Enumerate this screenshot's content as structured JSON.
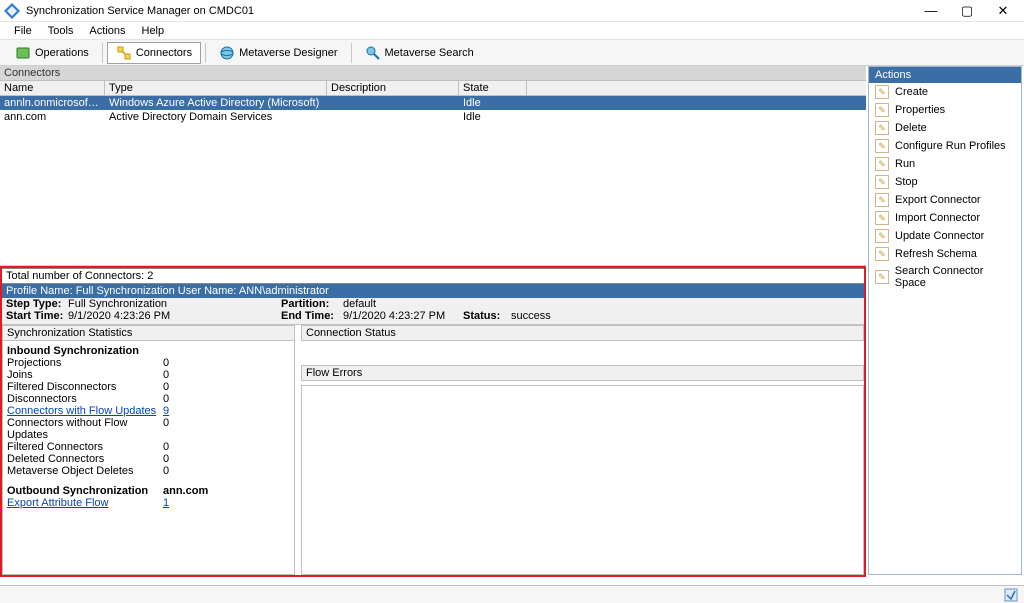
{
  "window": {
    "title": "Synchronization Service Manager on CMDC01"
  },
  "menu": {
    "file": "File",
    "tools": "Tools",
    "actions": "Actions",
    "help": "Help"
  },
  "toolbar": {
    "operations": "Operations",
    "connectors": "Connectors",
    "metaverse_designer": "Metaverse Designer",
    "metaverse_search": "Metaverse Search"
  },
  "connectors": {
    "title": "Connectors",
    "cols": {
      "name": "Name",
      "type": "Type",
      "description": "Description",
      "state": "State"
    },
    "rows": [
      {
        "name": "annln.onmicrosoft.com ...",
        "type": "Windows Azure Active Directory (Microsoft)",
        "description": "",
        "state": "Idle",
        "selected": true
      },
      {
        "name": "ann.com",
        "type": "Active Directory Domain Services",
        "description": "",
        "state": "Idle",
        "selected": false
      }
    ],
    "total_label": "Total number of Connectors: 2"
  },
  "actions_panel": {
    "title": "Actions",
    "items": [
      "Create",
      "Properties",
      "Delete",
      "Configure Run Profiles",
      "Run",
      "Stop",
      "Export Connector",
      "Import Connector",
      "Update Connector",
      "Refresh Schema",
      "Search Connector Space"
    ]
  },
  "profile": {
    "bar": "Profile Name: Full Synchronization   User Name: ANN\\administrator",
    "step_type_k": "Step Type:",
    "step_type_v": "Full Synchronization",
    "start_time_k": "Start Time:",
    "start_time_v": "9/1/2020 4:23:26 PM",
    "partition_k": "Partition:",
    "partition_v": "default",
    "end_time_k": "End Time:",
    "end_time_v": "9/1/2020 4:23:27 PM",
    "status_k": "Status:",
    "status_v": "success"
  },
  "stats": {
    "header": "Synchronization Statistics",
    "inbound_title": "Inbound Synchronization",
    "inbound": [
      {
        "label": "Projections",
        "value": "0"
      },
      {
        "label": "Joins",
        "value": "0"
      },
      {
        "label": "Filtered Disconnectors",
        "value": "0"
      },
      {
        "label": "Disconnectors",
        "value": "0"
      },
      {
        "label": "Connectors with Flow Updates",
        "value": "9",
        "link": true
      },
      {
        "label": "Connectors without Flow Updates",
        "value": "0"
      },
      {
        "label": "Filtered Connectors",
        "value": "0"
      },
      {
        "label": "Deleted Connectors",
        "value": "0"
      },
      {
        "label": "Metaverse Object Deletes",
        "value": "0"
      }
    ],
    "outbound_title": "Outbound Synchronization",
    "outbound_name": "ann.com",
    "outbound": [
      {
        "label": "Export Attribute Flow",
        "value": "1",
        "link": true
      }
    ]
  },
  "panes": {
    "conn_status": "Connection Status",
    "flow_errors": "Flow Errors"
  }
}
